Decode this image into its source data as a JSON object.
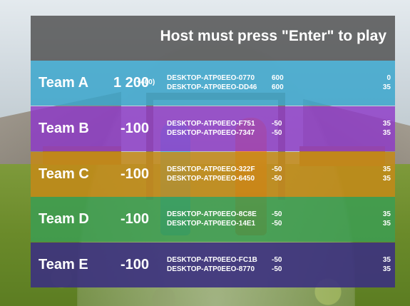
{
  "header": {
    "message": "Host must press \"Enter\" to play"
  },
  "colors": {
    "header_bg": "#464646",
    "team_a": "#3ba6cc",
    "team_b": "#8e39c8",
    "team_c": "#c48a18",
    "team_d": "#3c9d52",
    "team_e": "#3c3180"
  },
  "teams": [
    {
      "name": "Team A",
      "score": "1 200",
      "bonus": "(+400)",
      "players": [
        {
          "name": "DESKTOP-ATP0EEO-0770",
          "score": "600",
          "ping": "0"
        },
        {
          "name": "DESKTOP-ATP0EEO-DD46",
          "score": "600",
          "ping": "35"
        }
      ]
    },
    {
      "name": "Team B",
      "score": "-100",
      "bonus": "",
      "players": [
        {
          "name": "DESKTOP-ATP0EEO-F751",
          "score": "-50",
          "ping": "35"
        },
        {
          "name": "DESKTOP-ATP0EEO-7347",
          "score": "-50",
          "ping": "35"
        }
      ]
    },
    {
      "name": "Team C",
      "score": "-100",
      "bonus": "",
      "players": [
        {
          "name": "DESKTOP-ATP0EEO-322F",
          "score": "-50",
          "ping": "35"
        },
        {
          "name": "DESKTOP-ATP0EEO-6450",
          "score": "-50",
          "ping": "35"
        }
      ]
    },
    {
      "name": "Team D",
      "score": "-100",
      "bonus": "",
      "players": [
        {
          "name": "DESKTOP-ATP0EEO-8C8E",
          "score": "-50",
          "ping": "35"
        },
        {
          "name": "DESKTOP-ATP0EEO-14E1",
          "score": "-50",
          "ping": "35"
        }
      ]
    },
    {
      "name": "Team E",
      "score": "-100",
      "bonus": "",
      "players": [
        {
          "name": "DESKTOP-ATP0EEO-FC1B",
          "score": "-50",
          "ping": "35"
        },
        {
          "name": "DESKTOP-ATP0EEO-8770",
          "score": "-50",
          "ping": "35"
        }
      ]
    }
  ]
}
